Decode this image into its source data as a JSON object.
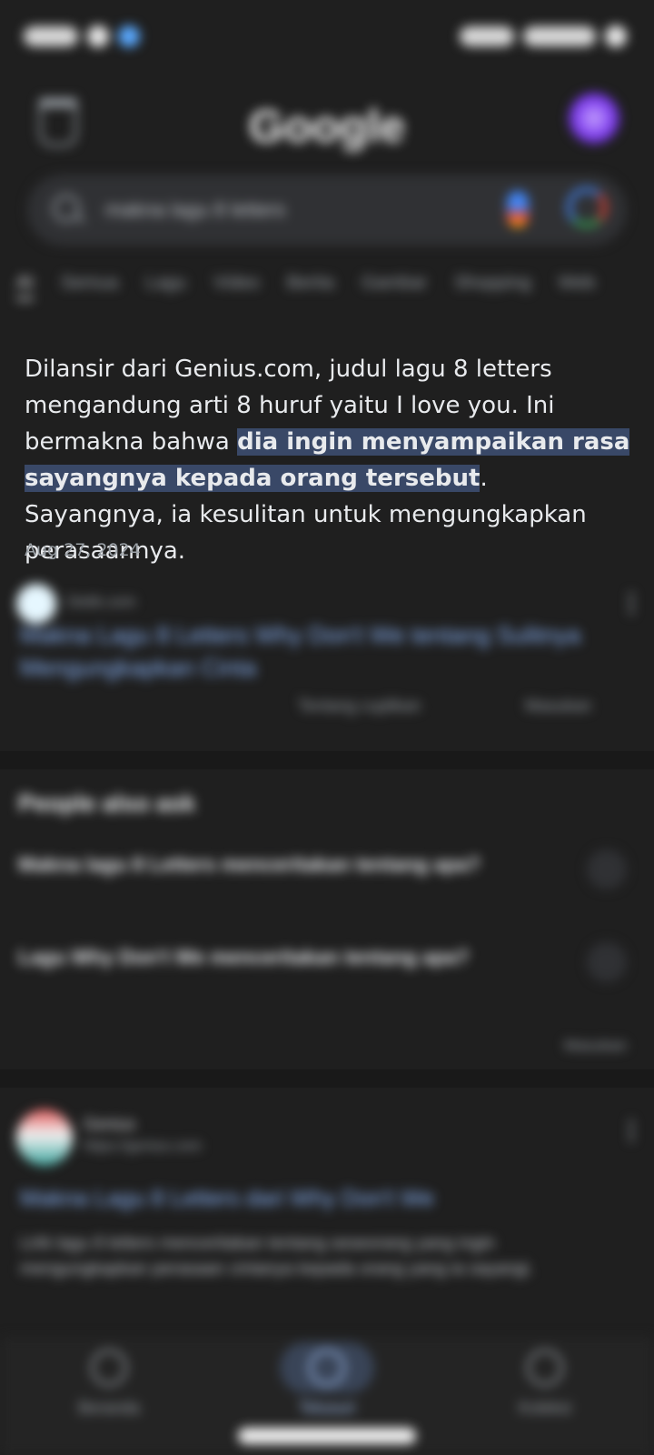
{
  "header": {
    "logo_text": "Google"
  },
  "search": {
    "query": "makna lagu 8 letters"
  },
  "tabs": [
    "AI",
    "Semua",
    "Lagu",
    "Video",
    "Berita",
    "Gambar",
    "Shopping",
    "Web"
  ],
  "snippet": {
    "text_before": "Dilansir dari Genius.com, judul lagu 8 letters mengandung arti 8 huruf yaitu I love you. Ini bermakna bahwa ",
    "highlight": "dia ingin menyampaikan rasa sayangnya kepada orang tersebut",
    "text_after": ". Sayangnya, ia kesulitan untuk mengungkapkan perasaannya.",
    "date": "Aug 27, 2024"
  },
  "source1": {
    "site": "Detik.com",
    "title": "Makna Lagu 8 Letters Why Don't We tentang Sulitnya Mengungkapkan Cinta",
    "meta1": "Tentang cuplikan",
    "meta2": "Masukan"
  },
  "people_also_ask": {
    "title": "People also ask",
    "questions": [
      "Makna lagu 8 Letters menceritakan tentang apa?",
      "Lagu Why Don't We menceritakan tentang apa?"
    ],
    "feedback": "Masukan"
  },
  "result2": {
    "site": "Genius",
    "url": "https://genius.com",
    "title": "Makna Lagu 8 Letters dari Why Don't We",
    "description": "Lirik lagu 8 letters menceritakan tentang seseorang yang ingin mengungkapkan perasaan cintanya kepada orang yang ia sayangi."
  },
  "nav": {
    "items": [
      {
        "label": "Beranda"
      },
      {
        "label": "Telusuri"
      },
      {
        "label": "Koleksi"
      }
    ]
  },
  "colors": {
    "background": "#1f1f1f",
    "highlight": "#394867",
    "link": "#8ab4f8",
    "accent": "#a8c7fa"
  }
}
